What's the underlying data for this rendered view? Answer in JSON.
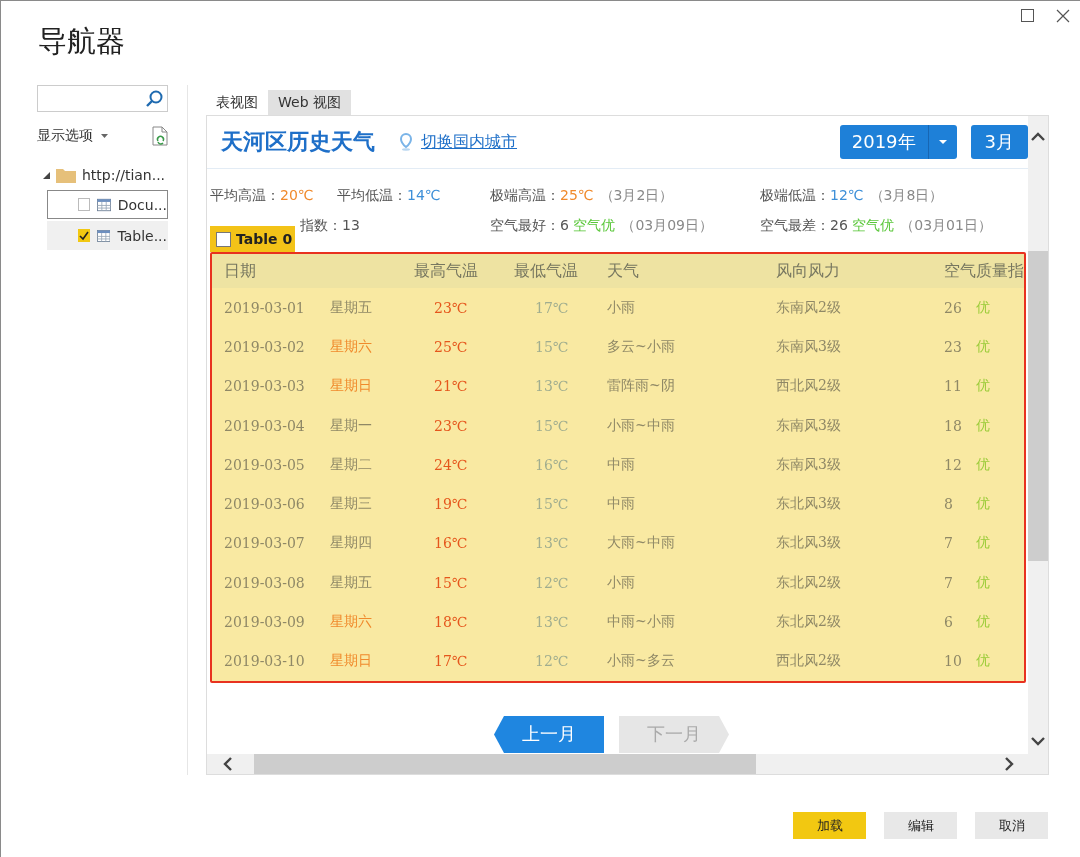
{
  "window": {
    "title": "导航器"
  },
  "sidebar": {
    "display_options": "显示选项",
    "tree": [
      {
        "label": "http://tian...",
        "expanded": true,
        "children": [
          {
            "label": "Docu...",
            "checked": false,
            "selected": false,
            "focused": true
          },
          {
            "label": "Table...",
            "checked": true,
            "selected": true,
            "focused": false
          }
        ]
      }
    ]
  },
  "tabs": [
    {
      "label": "表视图",
      "selected": false
    },
    {
      "label": "Web 视图",
      "selected": true
    }
  ],
  "web_page": {
    "title": "天河区历史天气",
    "city_link": "切换国内城市",
    "year": "2019年",
    "month": "3月",
    "stats": [
      {
        "label": "平均高温：",
        "value": "20℃",
        "color": "#f08a2c"
      },
      {
        "label": "平均低温：",
        "value": "14℃",
        "color": "#3d8fd8"
      },
      {
        "label": "极端高温：",
        "value": "25℃",
        "color": "#f08a2c",
        "note": "（3月2日）"
      },
      {
        "label": "极端低温：",
        "value": "12℃",
        "color": "#3d8fd8",
        "note": "（3月8日）"
      },
      {
        "label": "指数：",
        "value": "13",
        "color": "#555555"
      },
      {
        "label": "空气最好：",
        "value": "6",
        "color": "#555555",
        "badge": "空气优",
        "note": "（03月09日）"
      },
      {
        "label": "空气最差：",
        "value": "26",
        "color": "#555555",
        "badge": "空气优",
        "note": "（03月01日）"
      }
    ],
    "table_tag": {
      "label": "Table 0",
      "checked": false
    },
    "table": {
      "columns": [
        "日期",
        "最高气温",
        "最低气温",
        "天气",
        "风向风力",
        "空气质量指"
      ],
      "rows": [
        {
          "date": "2019-03-01",
          "weekday": "星期五",
          "weekend": false,
          "high": "23℃",
          "low": "17℃",
          "weather": "小雨",
          "wind": "东南风2级",
          "aqi": "26",
          "aqi_level": "优"
        },
        {
          "date": "2019-03-02",
          "weekday": "星期六",
          "weekend": true,
          "high": "25℃",
          "low": "15℃",
          "weather": "多云~小雨",
          "wind": "东南风3级",
          "aqi": "23",
          "aqi_level": "优"
        },
        {
          "date": "2019-03-03",
          "weekday": "星期日",
          "weekend": true,
          "high": "21℃",
          "low": "13℃",
          "weather": "雷阵雨~阴",
          "wind": "西北风2级",
          "aqi": "11",
          "aqi_level": "优"
        },
        {
          "date": "2019-03-04",
          "weekday": "星期一",
          "weekend": false,
          "high": "23℃",
          "low": "15℃",
          "weather": "小雨~中雨",
          "wind": "东南风3级",
          "aqi": "18",
          "aqi_level": "优"
        },
        {
          "date": "2019-03-05",
          "weekday": "星期二",
          "weekend": false,
          "high": "24℃",
          "low": "16℃",
          "weather": "中雨",
          "wind": "东南风3级",
          "aqi": "12",
          "aqi_level": "优"
        },
        {
          "date": "2019-03-06",
          "weekday": "星期三",
          "weekend": false,
          "high": "19℃",
          "low": "15℃",
          "weather": "中雨",
          "wind": "东北风3级",
          "aqi": "8",
          "aqi_level": "优"
        },
        {
          "date": "2019-03-07",
          "weekday": "星期四",
          "weekend": false,
          "high": "16℃",
          "low": "13℃",
          "weather": "大雨~中雨",
          "wind": "东北风3级",
          "aqi": "7",
          "aqi_level": "优"
        },
        {
          "date": "2019-03-08",
          "weekday": "星期五",
          "weekend": false,
          "high": "15℃",
          "low": "12℃",
          "weather": "小雨",
          "wind": "东北风2级",
          "aqi": "7",
          "aqi_level": "优"
        },
        {
          "date": "2019-03-09",
          "weekday": "星期六",
          "weekend": true,
          "high": "18℃",
          "low": "13℃",
          "weather": "中雨~小雨",
          "wind": "东北风2级",
          "aqi": "6",
          "aqi_level": "优"
        },
        {
          "date": "2019-03-10",
          "weekday": "星期日",
          "weekend": true,
          "high": "17℃",
          "low": "12℃",
          "weather": "小雨~多云",
          "wind": "西北风2级",
          "aqi": "10",
          "aqi_level": "优"
        }
      ]
    },
    "prev_button": {
      "label": "上一月",
      "disabled": false
    },
    "next_button": {
      "label": "下一月",
      "disabled": true
    }
  },
  "buttons": [
    {
      "label": "加载",
      "kind": "primary"
    },
    {
      "label": "编辑",
      "kind": "normal"
    },
    {
      "label": "取消",
      "kind": "normal"
    }
  ]
}
